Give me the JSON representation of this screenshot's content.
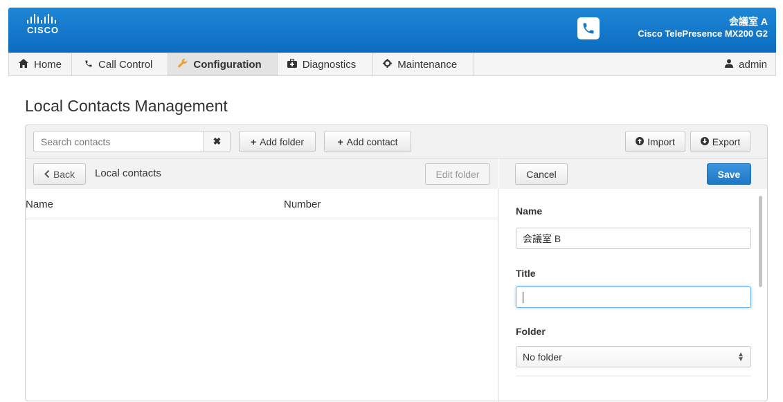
{
  "brand": {
    "logo_text": "CISCO",
    "accent": "#1479cb",
    "room_name": "会議室 A",
    "device_model": "Cisco TelePresence MX200 G2"
  },
  "nav": {
    "items": [
      {
        "label": "Home",
        "icon": "home-icon"
      },
      {
        "label": "Call Control",
        "icon": "phone-icon"
      },
      {
        "label": "Configuration",
        "icon": "wrench-icon",
        "active": true
      },
      {
        "label": "Diagnostics",
        "icon": "medkit-icon"
      },
      {
        "label": "Maintenance",
        "icon": "gear-icon"
      }
    ],
    "user": "admin"
  },
  "page": {
    "title": "Local Contacts Management"
  },
  "toolbar": {
    "search_placeholder": "Search contacts",
    "add_folder": "Add folder",
    "add_contact": "Add contact",
    "import": "Import",
    "export": "Export"
  },
  "list": {
    "back": "Back",
    "breadcrumb": "Local contacts",
    "edit_folder": "Edit folder",
    "columns": [
      "Name",
      "Number"
    ],
    "rows": []
  },
  "form": {
    "cancel": "Cancel",
    "save": "Save",
    "name_label": "Name",
    "name_value": "会議室 B",
    "title_label": "Title",
    "title_value": "",
    "folder_label": "Folder",
    "folder_value": "No folder"
  }
}
